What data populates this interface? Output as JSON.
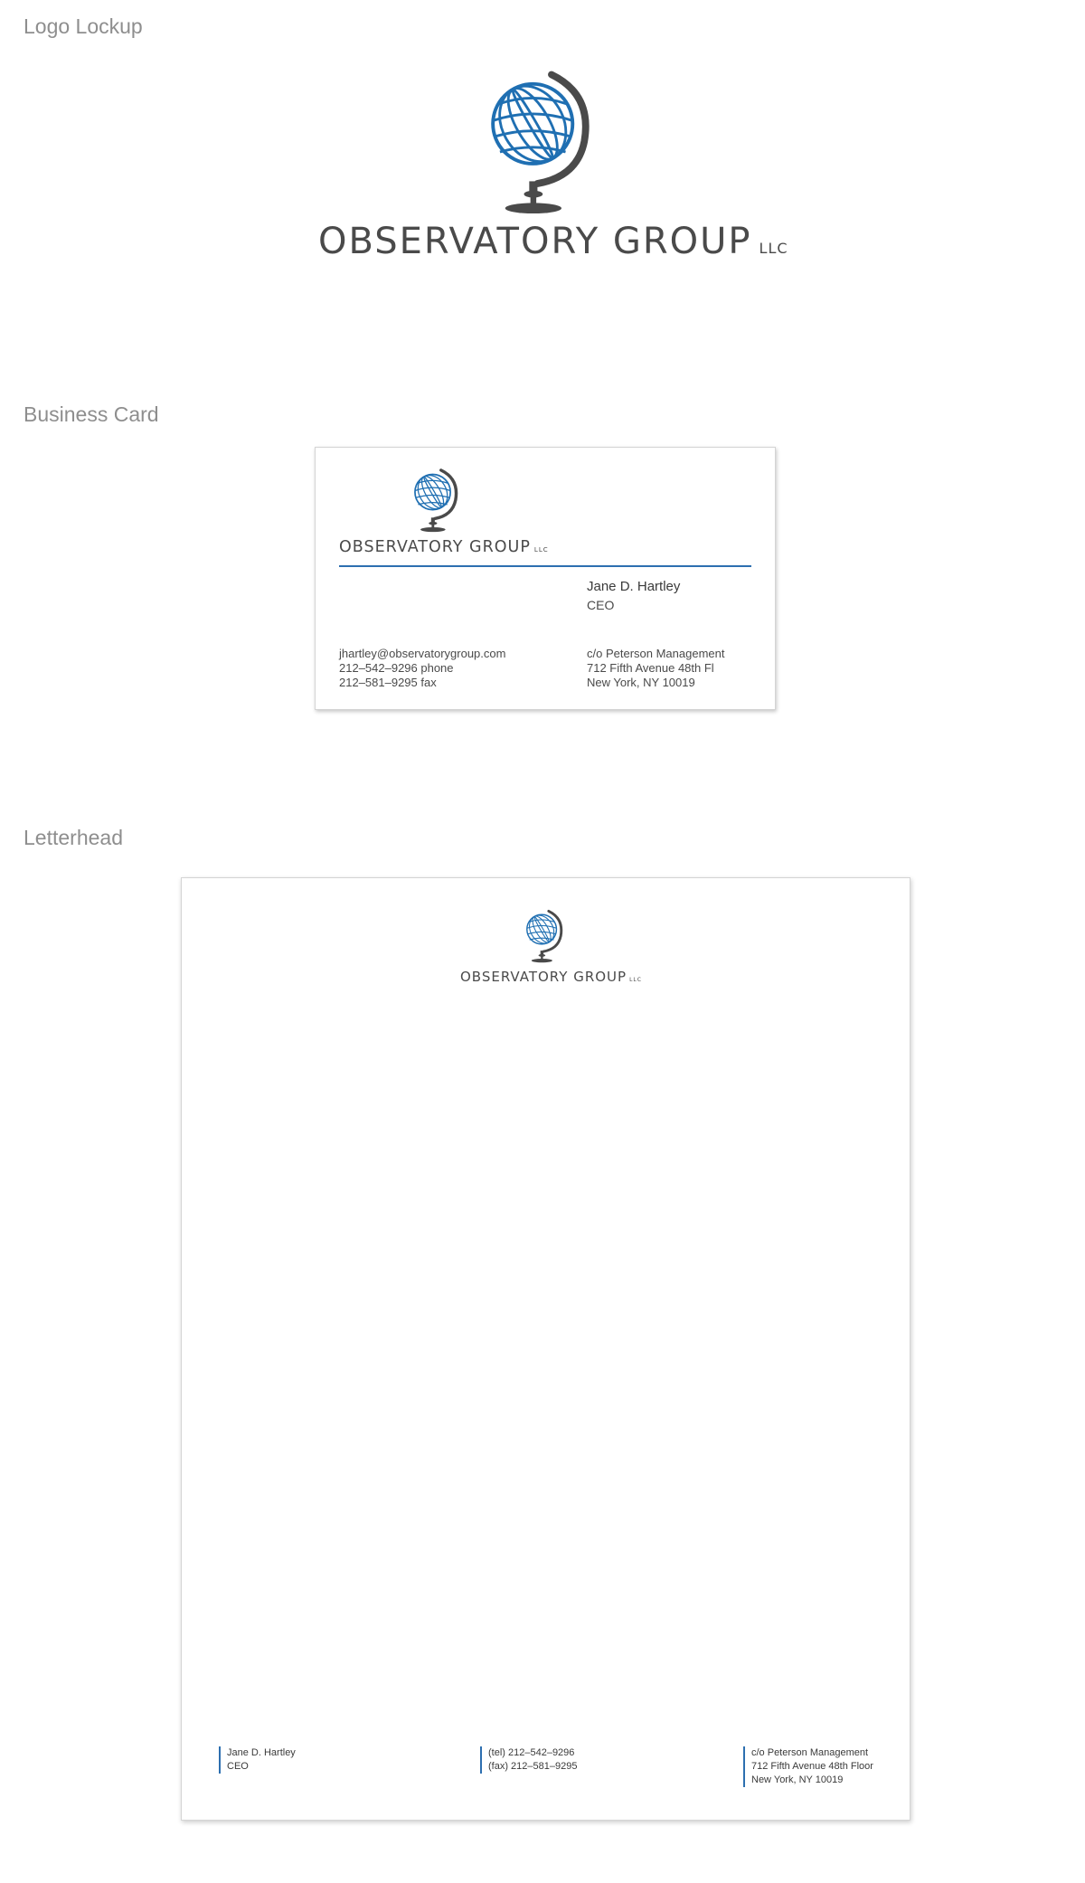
{
  "sections": {
    "logo_lockup": "Logo Lockup",
    "business_card": "Business Card",
    "letterhead": "Letterhead"
  },
  "brand": {
    "name": "OBSERVATORY GROUP",
    "suffix": "LLC",
    "colors": {
      "globe_blue": "#1f6fb2",
      "stand_gray": "#4a4a4a",
      "accent_rule": "#2d6fb0"
    }
  },
  "icons": {
    "logo": "globe-on-stand-icon"
  },
  "business_card": {
    "name": "Jane D. Hartley",
    "title": "CEO",
    "email": "jhartley@observatorygroup.com",
    "phone": "212–542–9296 phone",
    "fax": "212–581–9295 fax",
    "address_line1": "c/o Peterson Management",
    "address_line2": "712 Fifth Avenue 48th Fl",
    "address_line3": "New York, NY 10019"
  },
  "letterhead": {
    "name": "Jane D. Hartley",
    "title": "CEO",
    "tel": "(tel)  212–542–9296",
    "fax": "(fax)  212–581–9295",
    "address_line1": "c/o Peterson Management",
    "address_line2": "712 Fifth Avenue 48th Floor",
    "address_line3": "New York, NY 10019"
  }
}
